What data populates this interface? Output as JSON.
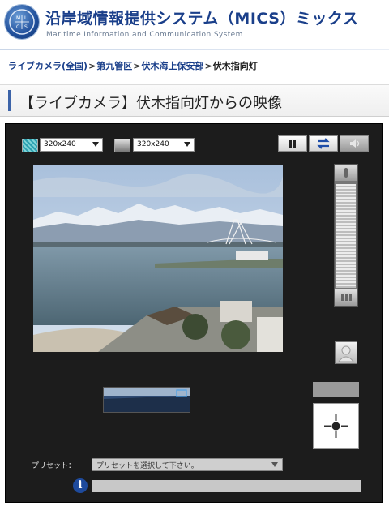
{
  "header": {
    "title": "沿岸域情報提供システム（MICS）ミックス",
    "subtitle": "Maritime Information and Communication System"
  },
  "breadcrumb": {
    "items": [
      "ライブカメラ(全国)",
      "第九管区",
      "伏木海上保安部"
    ],
    "separator": ">",
    "current": "伏木指向灯"
  },
  "page": {
    "title": "【ライブカメラ】伏木指向灯からの映像"
  },
  "viewer": {
    "color_resolution": "320x240",
    "gray_resolution": "320x240",
    "preset_label": "プリセット：",
    "preset_placeholder": "プリセットを選択して下さい。",
    "info_text": ""
  },
  "icons": {
    "logo": "mics-logo-icon",
    "pause": "pause-icon",
    "swap": "swap-arrows-icon",
    "sound": "speaker-icon",
    "person": "person-icon",
    "joystick": "crosshair-icon",
    "info": "info-icon"
  },
  "colors": {
    "brand_blue": "#1a3f8a",
    "panel_bg": "#1c1c1c",
    "accent": "#3c63a8"
  }
}
